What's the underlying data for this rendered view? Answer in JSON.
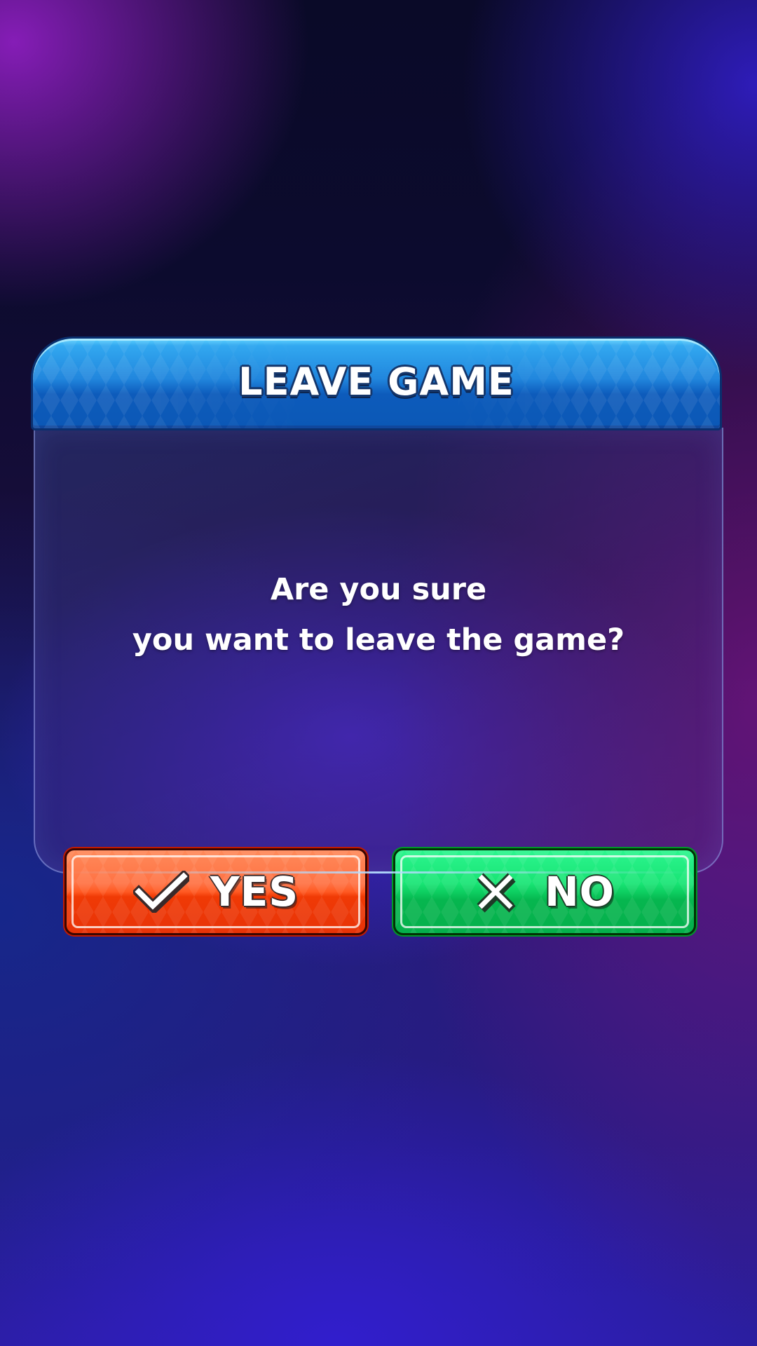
{
  "dialog": {
    "title": "LEAVE GAME",
    "message_line1": "Are you sure",
    "message_line2": "you want to leave the game?"
  },
  "buttons": {
    "yes": {
      "label": "YES",
      "icon": "checkmark-icon",
      "color": "#ff5a22"
    },
    "no": {
      "label": "NO",
      "icon": "cross-icon",
      "color": "#0ccb5e"
    }
  },
  "theme": {
    "header_color": "#2186dd",
    "background_color": "#1a0e3e"
  }
}
